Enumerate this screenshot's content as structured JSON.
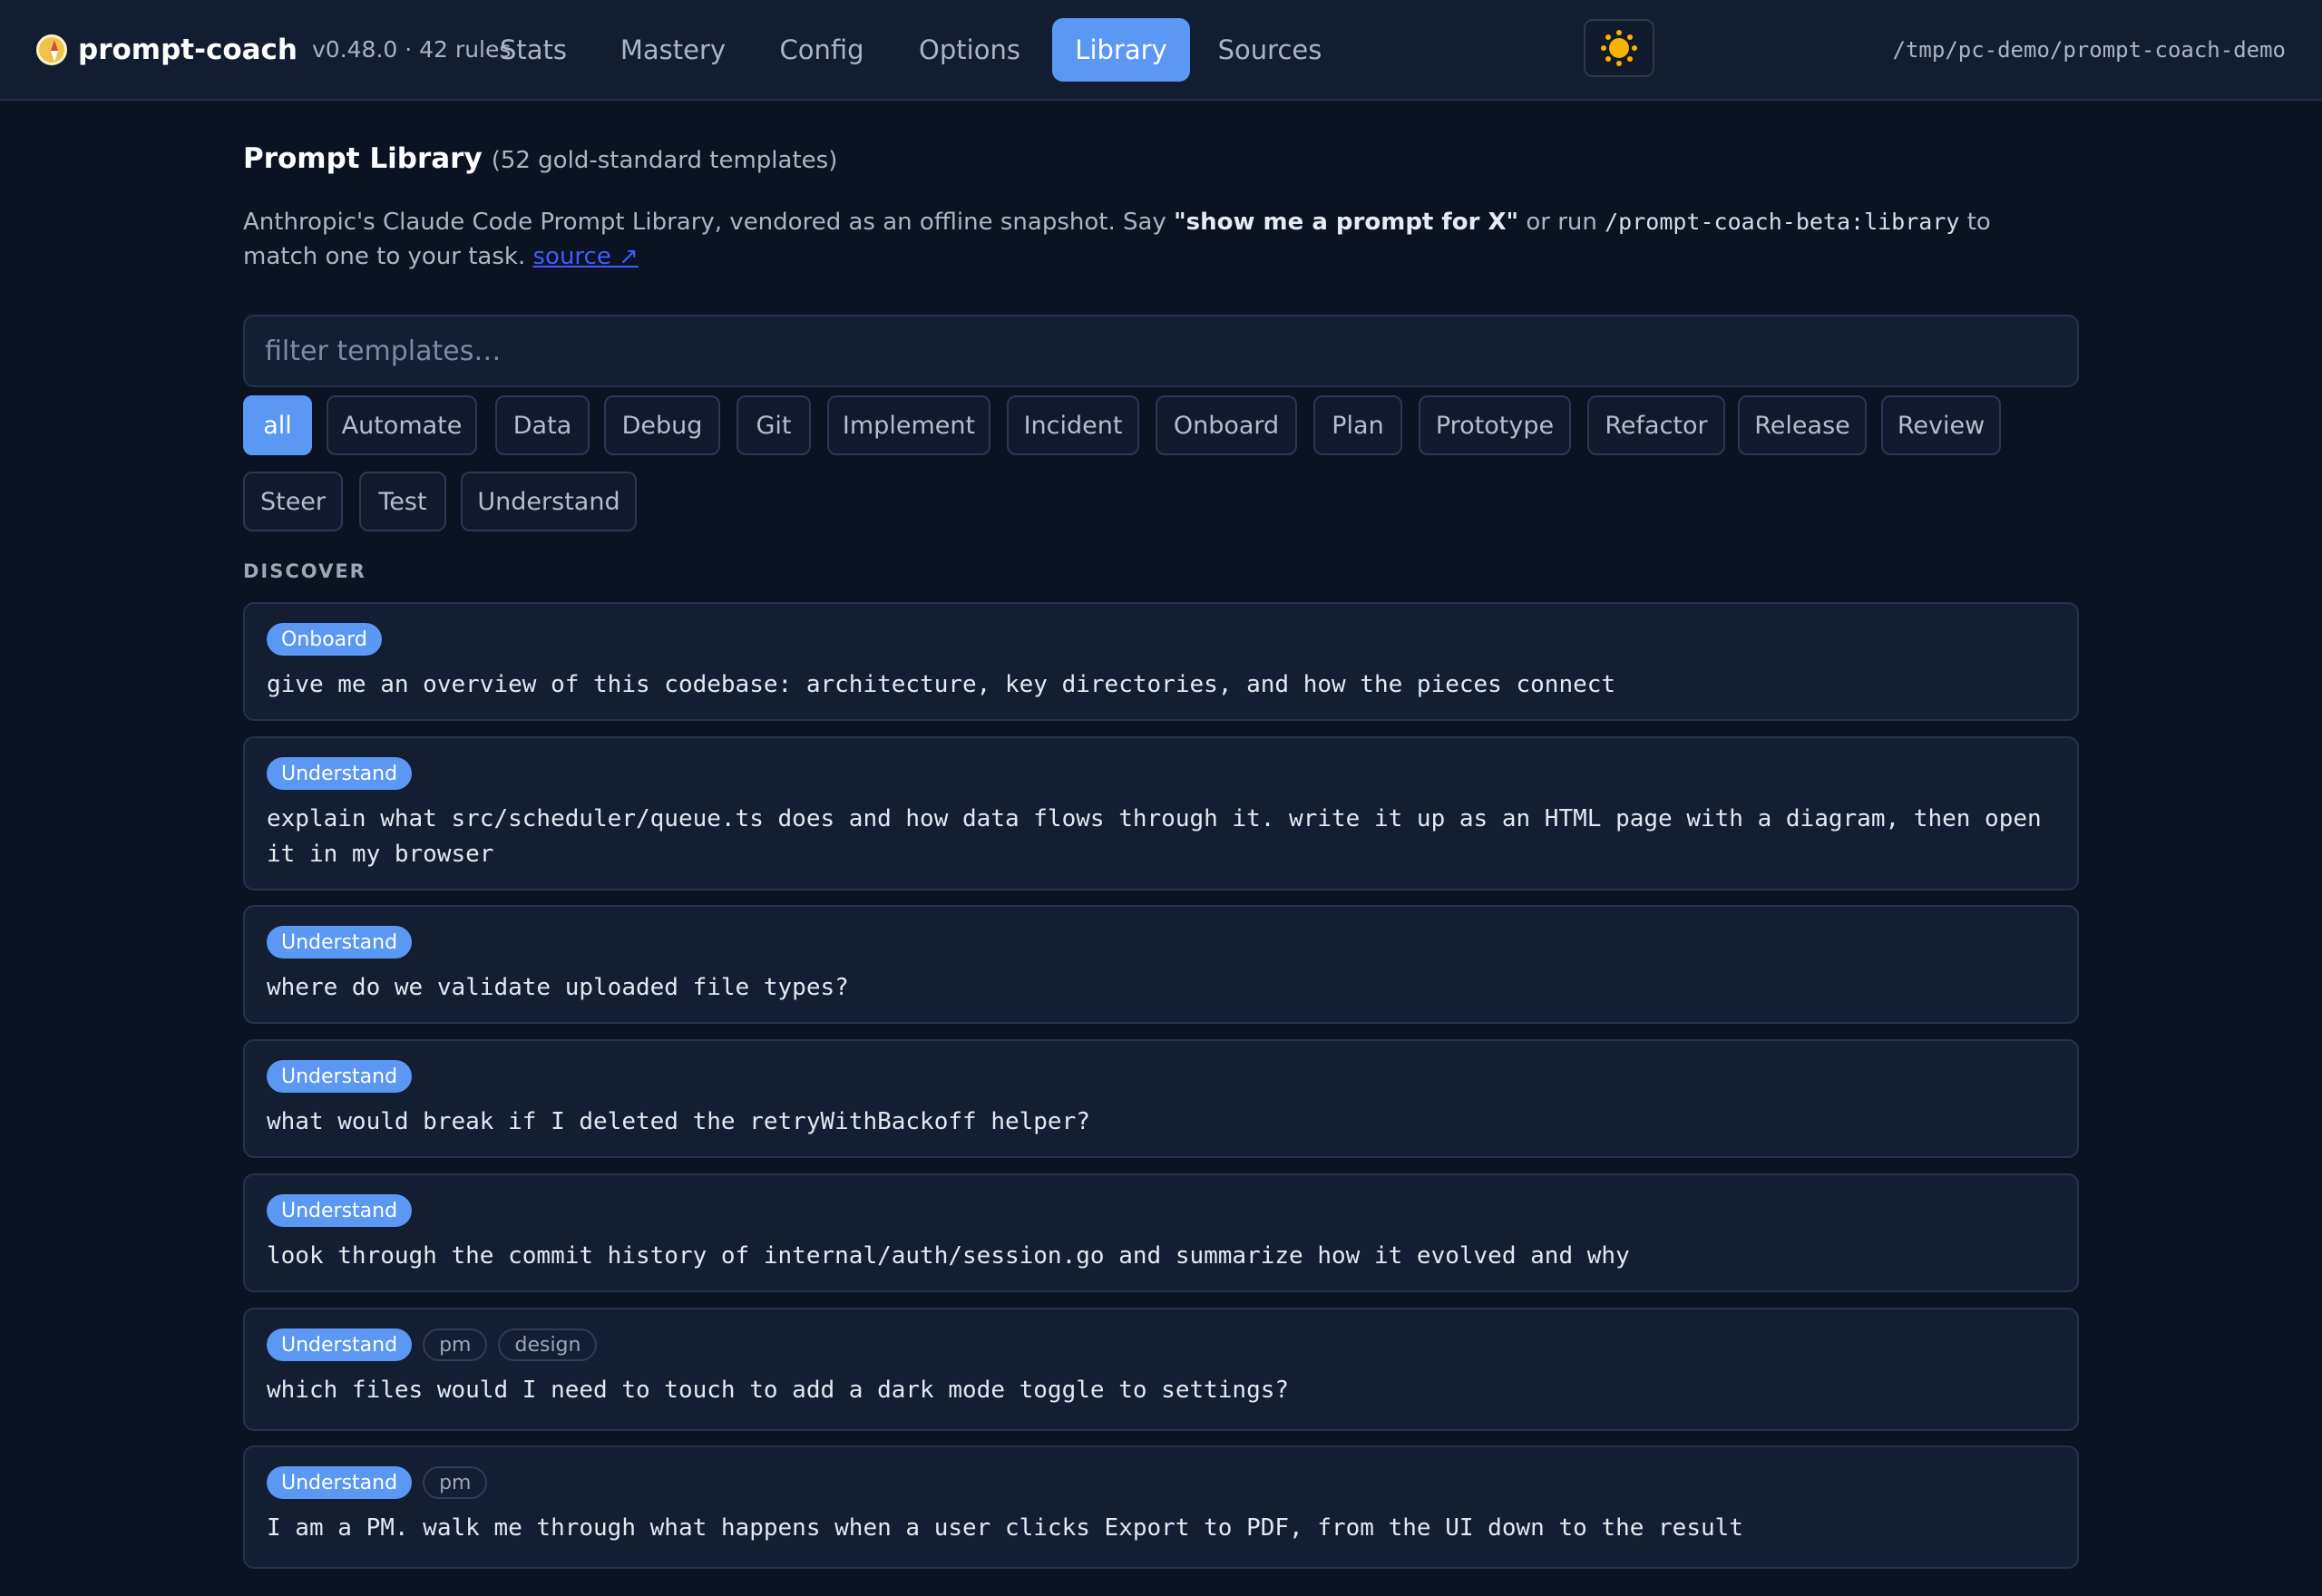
{
  "header": {
    "app_name": "prompt-coach",
    "meta": "v0.48.0 · 42 rules",
    "tabs": [
      "Stats",
      "Mastery",
      "Config",
      "Options",
      "Library",
      "Sources"
    ],
    "active_tab": "Library",
    "theme_icon": "sun-icon",
    "path": "/tmp/pc-demo/prompt-coach-demo"
  },
  "library": {
    "title": "Prompt Library",
    "subtitle": "(52 gold-standard templates)",
    "intro": {
      "before": "Anthropic's Claude Code Prompt Library, vendored as an offline snapshot. Say ",
      "bold": "\"show me a prompt for X\"",
      "middle": " or run ",
      "command": "/prompt-coach-beta:library",
      "after": " to match one to your task. ",
      "link": "source ↗"
    },
    "filter_placeholder": "filter templates…",
    "categories": [
      "all",
      "Automate",
      "Data",
      "Debug",
      "Git",
      "Implement",
      "Incident",
      "Onboard",
      "Plan",
      "Prototype",
      "Refactor",
      "Release",
      "Review",
      "Steer",
      "Test",
      "Understand"
    ],
    "active_category": "all",
    "section": "DISCOVER",
    "templates": [
      {
        "category": "Onboard",
        "tags": [],
        "text": "give me an overview of this codebase: architecture, key directories, and how the pieces connect"
      },
      {
        "category": "Understand",
        "tags": [],
        "text": "explain what src/scheduler/queue.ts does and how data flows through it. write it up as an HTML page with a diagram, then open it in my browser"
      },
      {
        "category": "Understand",
        "tags": [],
        "text": "where do we validate uploaded file types?"
      },
      {
        "category": "Understand",
        "tags": [],
        "text": "what would break if I deleted the retryWithBackoff helper?"
      },
      {
        "category": "Understand",
        "tags": [],
        "text": "look through the commit history of internal/auth/session.go and summarize how it evolved and why"
      },
      {
        "category": "Understand",
        "tags": [
          "pm",
          "design"
        ],
        "text": "which files would I need to touch to add a dark mode toggle to settings?"
      },
      {
        "category": "Understand",
        "tags": [
          "pm"
        ],
        "text": "I am a PM. walk me through what happens when a user clicks Export to PDF, from the UI down to the result"
      }
    ]
  }
}
